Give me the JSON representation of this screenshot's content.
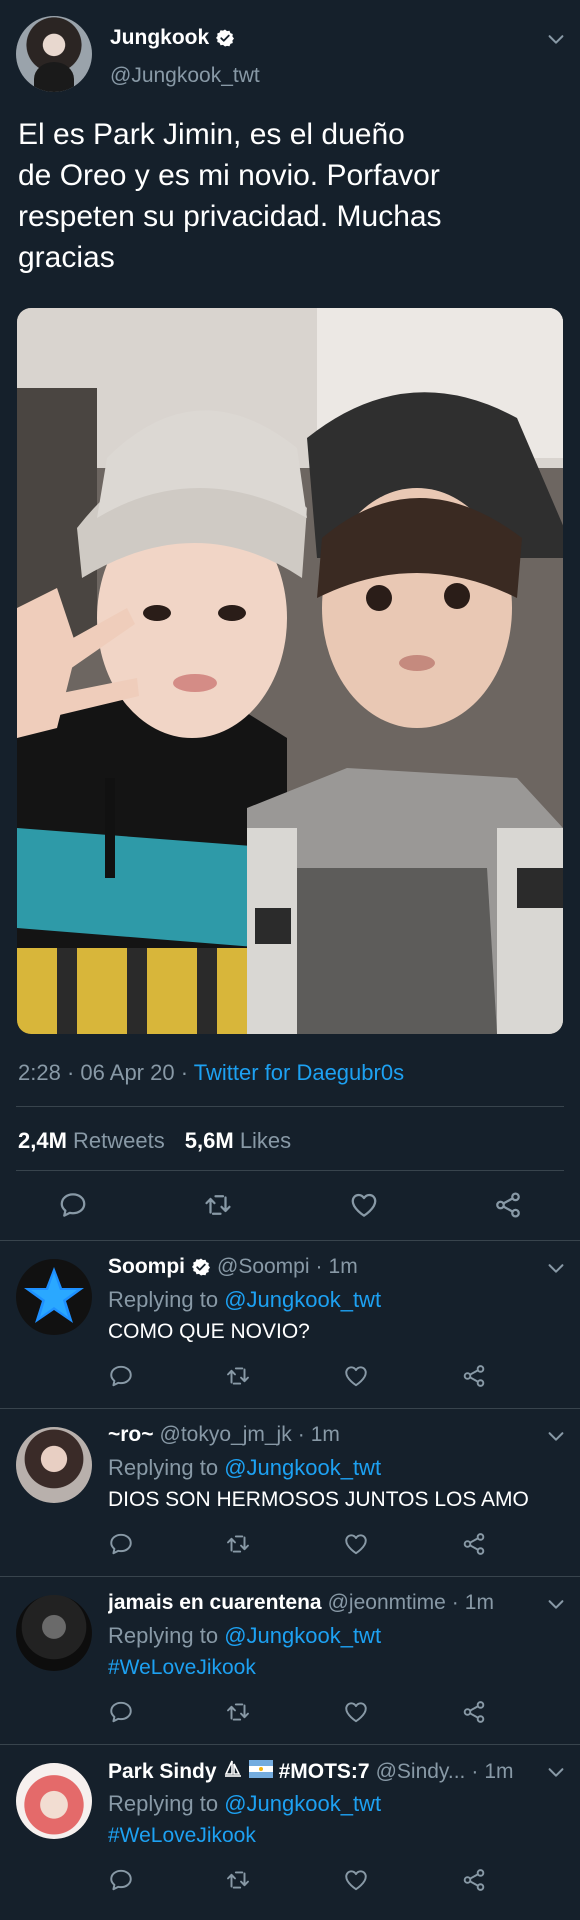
{
  "tweet": {
    "name": "Jungkook",
    "handle": "@Jungkook_twt",
    "text": "El es Park Jimin, es el dueño\nde Oreo y es mi novio. Porfavor\nrespeten su privacidad. Muchas\ngracias",
    "time": "2:28",
    "date": "06 Apr 20",
    "source": "Twitter for Daegubr0s",
    "retweets": "2,4M",
    "retweets_label": "Retweets",
    "likes": "5,6M",
    "likes_label": "Likes"
  },
  "replies": [
    {
      "name": "Soompi",
      "handle": "@Soompi",
      "age": "1m",
      "replying_label": "Replying to",
      "replying_to": "@Jungkook_twt",
      "text": "COMO QUE NOVIO?"
    },
    {
      "name": "~ro~",
      "handle": "@tokyo_jm_jk",
      "age": "1m",
      "replying_label": "Replying to",
      "replying_to": "@Jungkook_twt",
      "text": "DIOS SON HERMOSOS JUNTOS LOS AMO"
    },
    {
      "name": "jamais en cuarentena",
      "handle": "@jeonmtime",
      "age": "1m",
      "replying_label": "Replying to",
      "replying_to": "@Jungkook_twt",
      "text": "#WeLoveJikook"
    },
    {
      "name": "Park Sindy",
      "name_suffix": "#MOTS:7",
      "handle": "@Sindy...",
      "age": "1m",
      "replying_label": "Replying to",
      "replying_to": "@Jungkook_twt",
      "text": "#WeLoveJikook"
    }
  ],
  "colors": {
    "background": "#15202b",
    "text": "#ffffff",
    "muted": "#8899a6",
    "accent": "#1da1f2",
    "divider": "#38444d"
  },
  "icons": [
    "verified-badge-icon",
    "chevron-down-icon",
    "reply-icon",
    "retweet-icon",
    "like-icon",
    "share-icon",
    "sailboat-icon",
    "argentina-flag-icon"
  ]
}
